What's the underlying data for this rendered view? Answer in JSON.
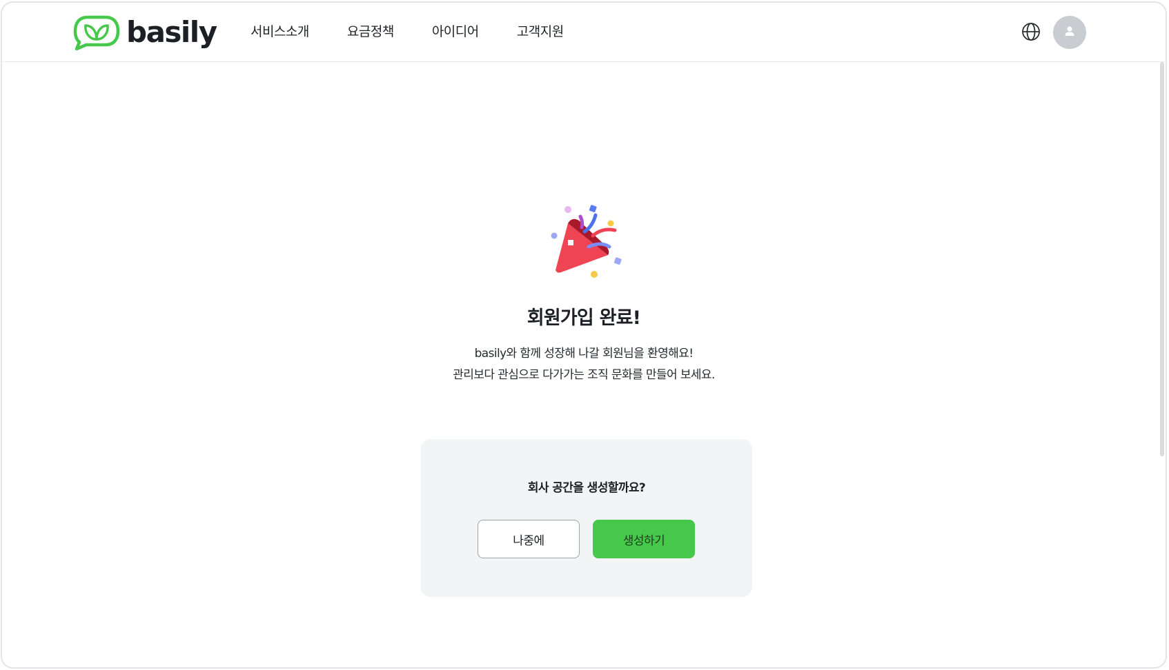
{
  "header": {
    "logo_text": "basily",
    "nav": [
      {
        "label": "서비스소개"
      },
      {
        "label": "요금정책"
      },
      {
        "label": "아이디어"
      },
      {
        "label": "고객지원"
      }
    ],
    "globe_icon": "globe-icon",
    "avatar_icon": "user-icon"
  },
  "main": {
    "illustration": "party-popper-icon",
    "title": "회원가입 완료!",
    "desc_line1": "basily와 함께 성장해 나갈 회원님을 환영해요!",
    "desc_line2": "관리보다 관심으로 다가가는 조직 문화를 만들어 보세요.",
    "card": {
      "question": "회사 공간을 생성할까요?",
      "later_label": "나중에",
      "create_label": "생성하기"
    }
  },
  "colors": {
    "brand_green": "#46c84b",
    "card_bg": "#f3f4f5",
    "avatar_bg": "#c9ccd1"
  }
}
